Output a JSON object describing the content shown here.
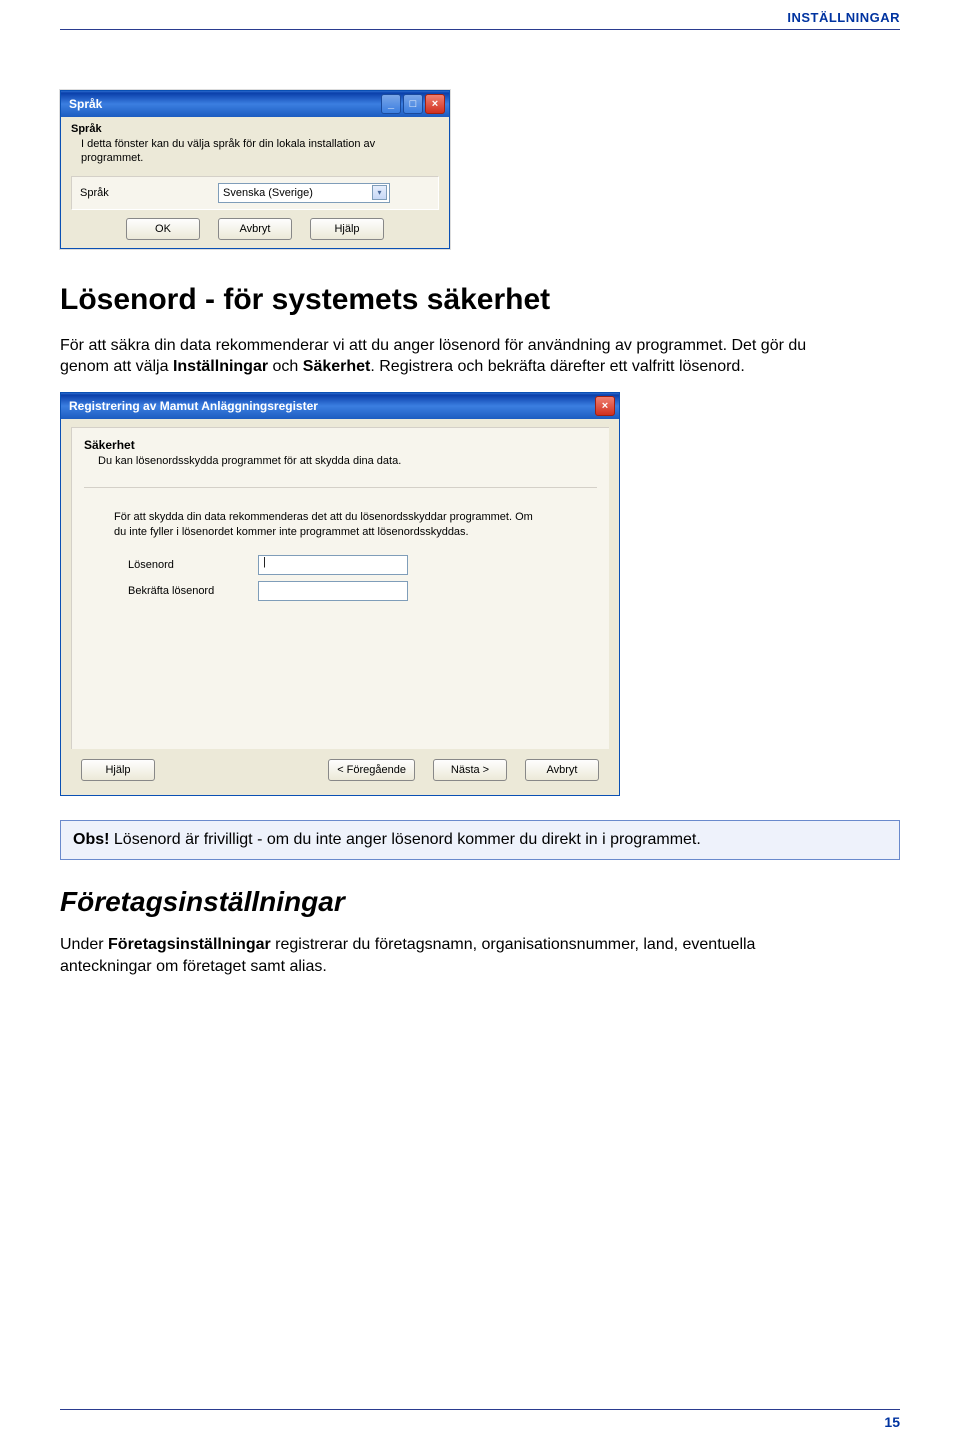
{
  "header": {
    "title": "INSTÄLLNINGAR"
  },
  "dialog1": {
    "title": "Språk",
    "heading": "Språk",
    "description": "I detta fönster kan du välja språk för din lokala installation av programmet.",
    "field_label": "Språk",
    "selected": "Svenska (Sverige)",
    "buttons": {
      "ok": "OK",
      "cancel": "Avbryt",
      "help": "Hjälp"
    },
    "win_min": "_",
    "win_max": "□",
    "win_close": "×"
  },
  "section1": {
    "title": "Lösenord - för systemets säkerhet",
    "p1_a": "För att säkra din data rekommenderar vi att du anger lösenord för användning av programmet. Det gör du genom att välja ",
    "p1_b": "Inställningar",
    "p1_c": " och ",
    "p1_d": "Säkerhet",
    "p1_e": ". Registrera och bekräfta därefter ett valfritt lösenord."
  },
  "dialog2": {
    "title": "Registrering av Mamut Anläggningsregister",
    "win_close": "×",
    "heading": "Säkerhet",
    "subdesc": "Du kan lösenordsskydda programmet för att skydda dina data.",
    "body": "För att skydda din data rekommenderas det att du lösenordsskyddar programmet. Om du inte fyller i lösenordet kommer inte programmet att lösenordsskyddas.",
    "password_label": "Lösenord",
    "confirm_label": "Bekräfta lösenord",
    "password_value": "|",
    "buttons": {
      "help": "Hjälp",
      "prev": "< Föregående",
      "next": "Nästa >",
      "cancel": "Avbryt"
    }
  },
  "note": {
    "prefix": "Obs!",
    "text": " Lösenord är frivilligt - om du inte anger lösenord kommer du direkt in i programmet."
  },
  "section2": {
    "title": "Företagsinställningar",
    "p_a": "Under ",
    "p_b": "Företagsinställningar",
    "p_c": " registrerar du företagsnamn, organisationsnummer, land, eventuella anteckningar om företaget samt alias."
  },
  "footer": {
    "page": "15"
  }
}
